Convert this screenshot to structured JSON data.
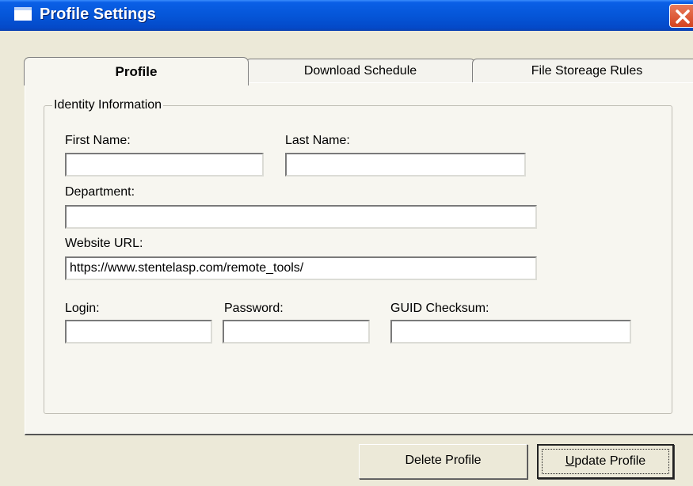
{
  "window": {
    "title": "Profile Settings"
  },
  "tabs": [
    {
      "label": "Profile",
      "active": true
    },
    {
      "label": "Download Schedule",
      "active": false
    },
    {
      "label": "File Storeage Rules",
      "active": false
    }
  ],
  "identity": {
    "group_label": "Identity Information",
    "first_name": {
      "label": "First Name:",
      "value": ""
    },
    "last_name": {
      "label": "Last Name:",
      "value": ""
    },
    "department": {
      "label": "Department:",
      "value": ""
    },
    "website_url": {
      "label": "Website URL:",
      "value": "https://www.stentelasp.com/remote_tools/"
    },
    "login": {
      "label": "Login:",
      "value": ""
    },
    "password": {
      "label": "Password:",
      "value": ""
    },
    "guid_checksum": {
      "label": "GUID Checksum:",
      "value": ""
    }
  },
  "buttons": {
    "delete_label": "Delete Profile",
    "update_mnemonic": "U",
    "update_rest": "pdate Profile"
  },
  "colors": {
    "titlebar": "#0556d8",
    "close_button": "#d4421e",
    "dialog_background": "#ece9d8",
    "tab_panel": "#f7f6f0"
  }
}
